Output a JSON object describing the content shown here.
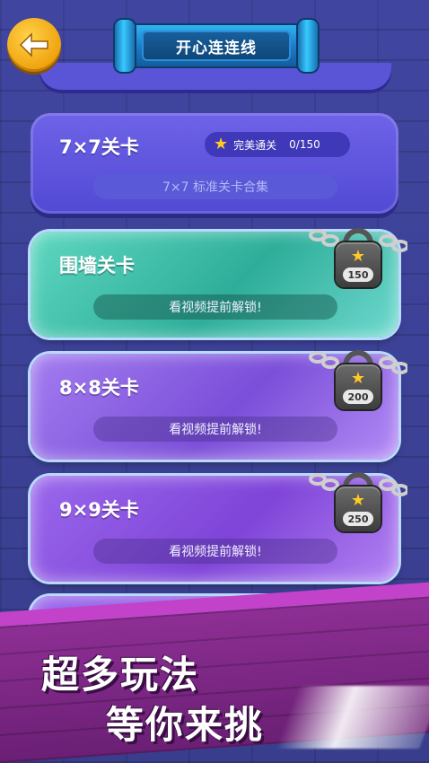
{
  "header": {
    "title": "开心连连线",
    "back_icon": "back-arrow-icon"
  },
  "levels": [
    {
      "title": "7×7关卡",
      "subtitle": "7×7 标准关卡合集",
      "stars_label": "完美通关",
      "progress": "0/150",
      "locked": false
    },
    {
      "title": "围墙关卡",
      "subtitle": "看视频提前解锁!",
      "unlock_stars": "150",
      "locked": true
    },
    {
      "title": "8×8关卡",
      "subtitle": "看视频提前解锁!",
      "unlock_stars": "200",
      "locked": true
    },
    {
      "title": "9×9关卡",
      "subtitle": "看视频提前解锁!",
      "unlock_stars": "250",
      "locked": true
    }
  ],
  "promo": {
    "line1": "超多玩法",
    "line2": "等你来挑"
  },
  "colors": {
    "accent_gold": "#ffc928",
    "blue_card": "#5f56dd",
    "green_card": "#3fbfa8",
    "purple_card": "#8a5ae0",
    "banner": "#7c2585"
  }
}
